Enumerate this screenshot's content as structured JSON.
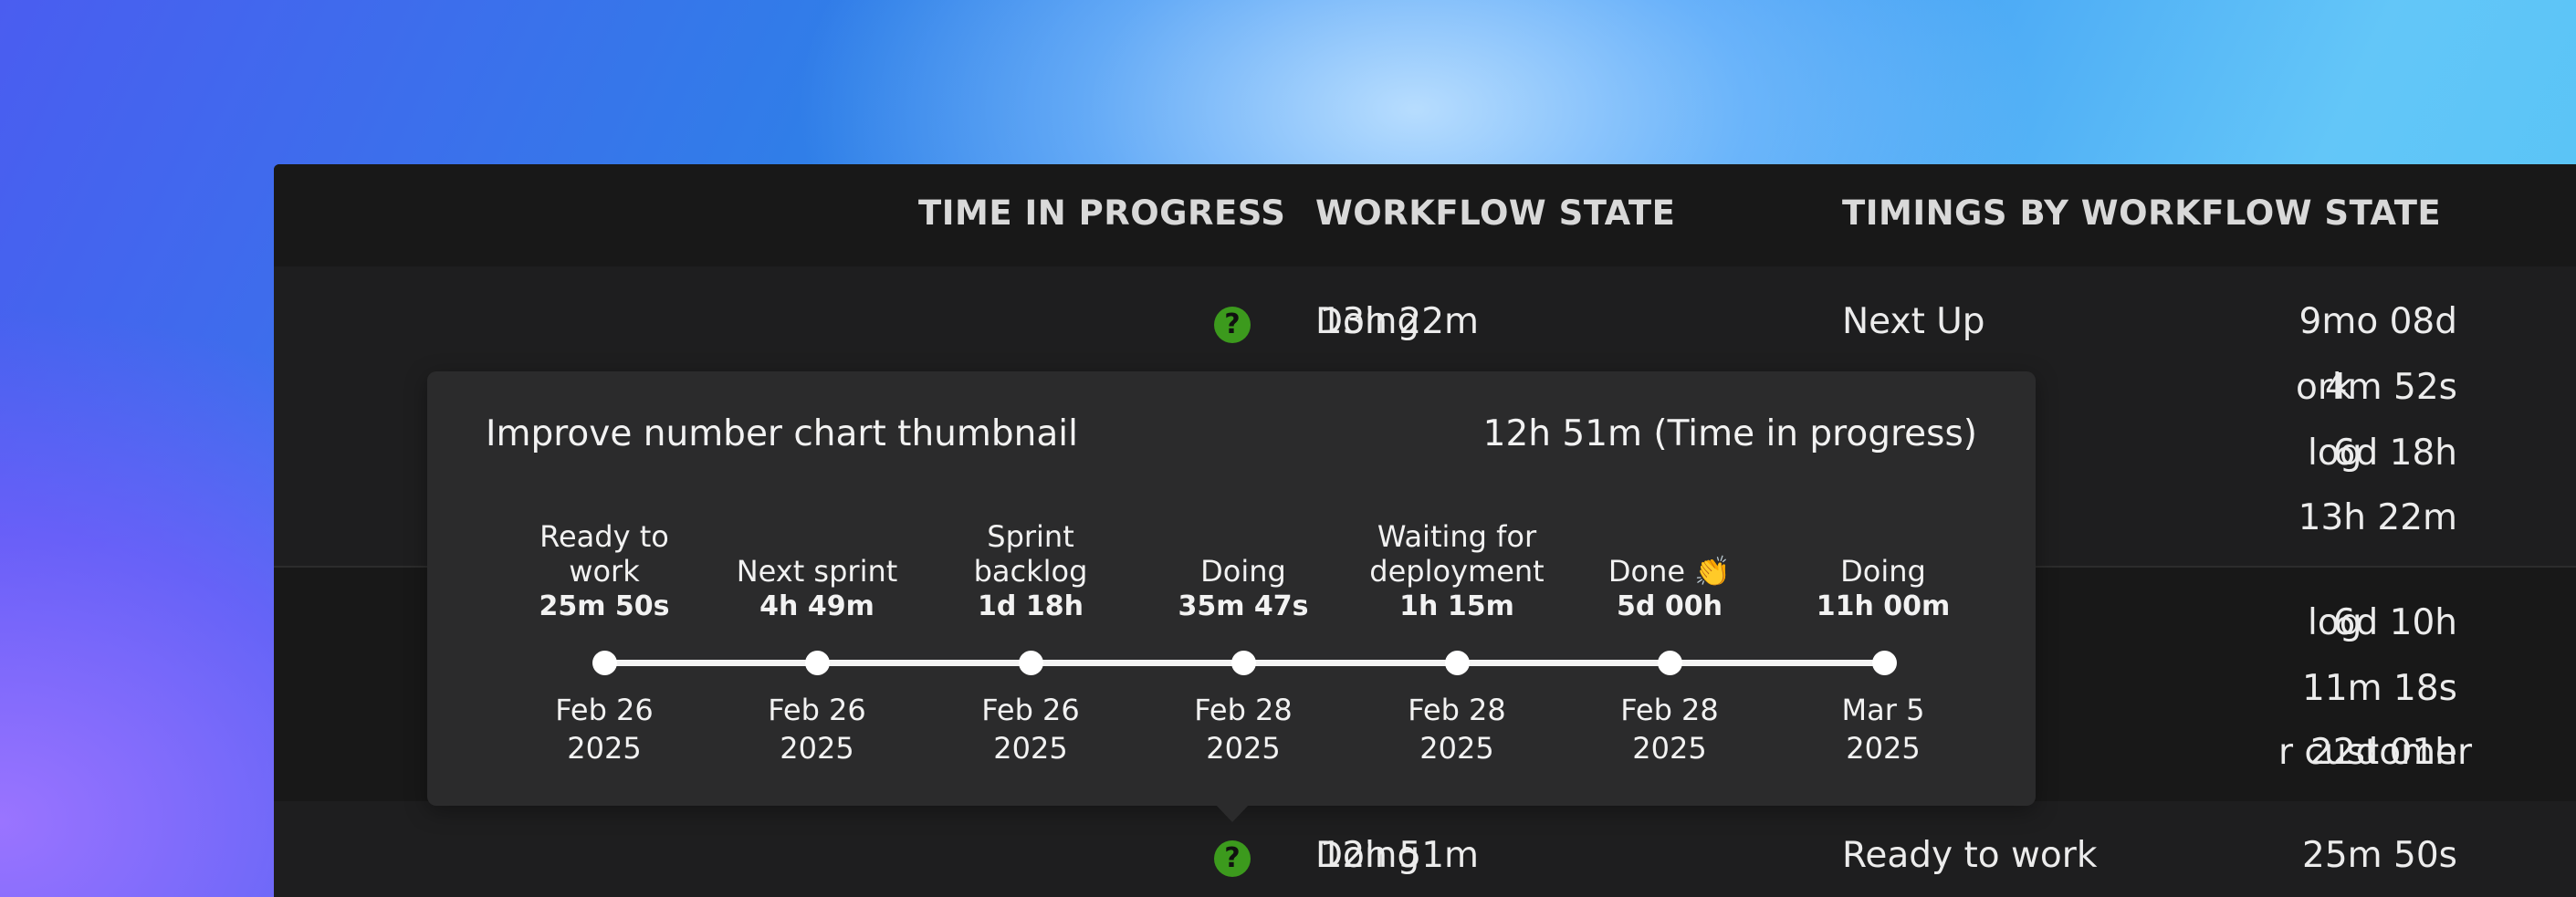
{
  "table": {
    "headers": {
      "time_in_progress": "TIME IN PROGRESS",
      "workflow_state": "WORKFLOW STATE",
      "timings": "TIMINGS BY WORKFLOW STATE"
    },
    "help_icon": "?",
    "rows": [
      {
        "time": "13h 22m",
        "state": "Doing",
        "timings": [
          {
            "label": "Next Up",
            "value": "9mo 08d"
          },
          {
            "label": "ork",
            "value": "4m 52s"
          },
          {
            "label": "log",
            "value": "6d 18h"
          },
          {
            "label": "",
            "value": "13h 22m"
          }
        ]
      },
      {
        "time": "",
        "state": "",
        "timings": [
          {
            "label": "log",
            "value": "6d 10h"
          },
          {
            "label": "",
            "value": "11m 18s"
          },
          {
            "label": "r customer",
            "value": "22d 01h"
          }
        ]
      },
      {
        "time": "12h 51m",
        "state": "Doing",
        "timings": [
          {
            "label": "Ready to work",
            "value": "25m 50s"
          }
        ]
      }
    ]
  },
  "tooltip": {
    "title": "Improve number chart thumbnail",
    "total": "12h 51m (Time in progress)",
    "stages": [
      {
        "name_line1": "Ready to",
        "name_line2": "work",
        "duration": "25m 50s",
        "date_line1": "Feb 26",
        "date_line2": "2025"
      },
      {
        "name_line1": "",
        "name_line2": "Next sprint",
        "duration": "4h 49m",
        "date_line1": "Feb 26",
        "date_line2": "2025"
      },
      {
        "name_line1": "Sprint",
        "name_line2": "backlog",
        "duration": "1d 18h",
        "date_line1": "Feb 26",
        "date_line2": "2025"
      },
      {
        "name_line1": "",
        "name_line2": "Doing",
        "duration": "35m 47s",
        "date_line1": "Feb 28",
        "date_line2": "2025"
      },
      {
        "name_line1": "Waiting for",
        "name_line2": "deployment",
        "duration": "1h 15m",
        "date_line1": "Feb 28",
        "date_line2": "2025"
      },
      {
        "name_line1": "",
        "name_line2": "Done 👏",
        "duration": "5d 00h",
        "date_line1": "Feb 28",
        "date_line2": "2025"
      },
      {
        "name_line1": "",
        "name_line2": "Doing",
        "duration": "11h 00m",
        "date_line1": "Mar 5",
        "date_line2": "2025"
      }
    ]
  },
  "colors": {
    "panel": "#1e1e1f",
    "header": "#181818",
    "tooltip": "#2b2b2c",
    "help_icon": "#3c9a1d"
  }
}
